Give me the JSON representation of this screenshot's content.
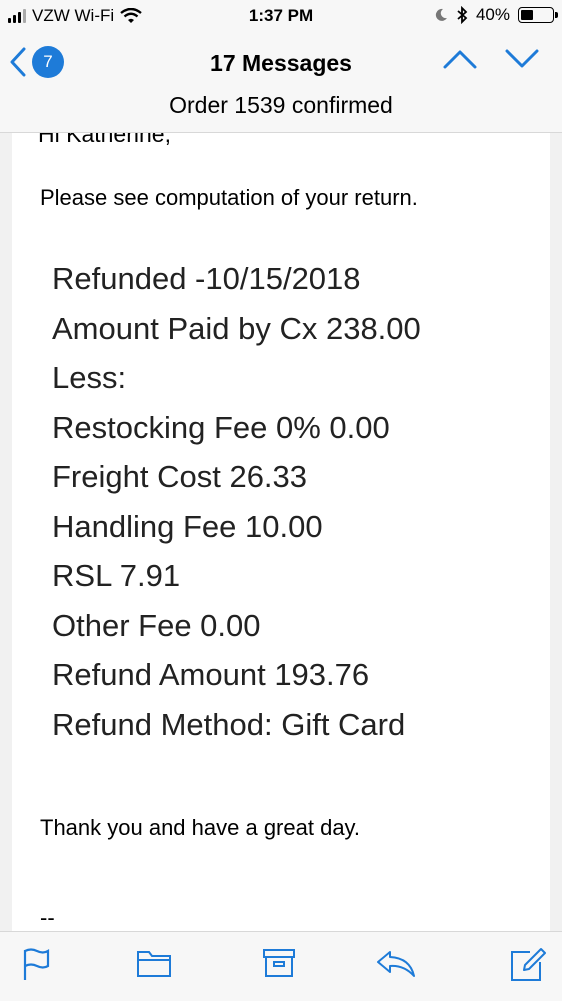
{
  "status_bar": {
    "carrier": "VZW Wi-Fi",
    "time": "1:37 PM",
    "battery_percent": "40%",
    "battery_level": 0.4
  },
  "nav": {
    "unread_count": "7",
    "title": "17 Messages",
    "subtitle": "Order 1539 confirmed"
  },
  "email": {
    "cut_greeting": "Hi Katherine,",
    "intro": "Please see computation of your return.",
    "lines": [
      "Refunded -10/15/2018",
      "Amount Paid by Cx 238.00",
      "Less:",
      "Restocking Fee 0% 0.00",
      "Freight Cost 26.33",
      "Handling Fee 10.00",
      "RSL 7.91",
      "Other Fee 0.00",
      "Refund Amount 193.76",
      "Refund Method: Gift Card"
    ],
    "closing": "Thank you and have a great day.",
    "signature_start": "--"
  },
  "colors": {
    "accent": "#1e7bd8",
    "bar_bg": "#f7f7f7"
  },
  "icons": {
    "toolbar": [
      "flag-icon",
      "folder-icon",
      "archive-icon",
      "reply-icon",
      "compose-icon"
    ]
  }
}
